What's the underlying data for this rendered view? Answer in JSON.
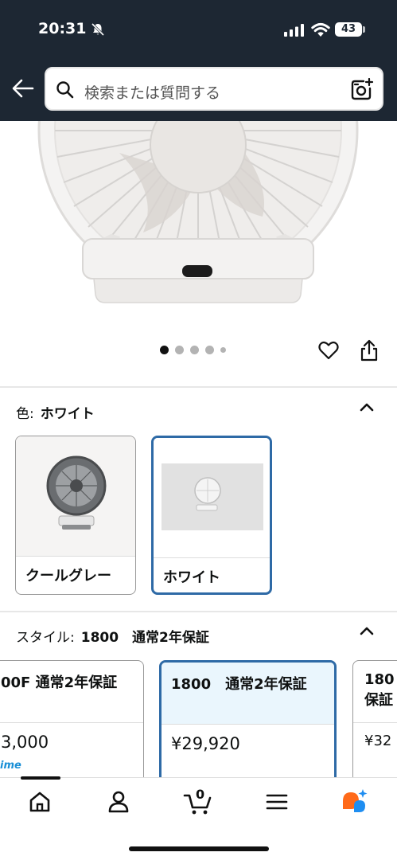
{
  "status_bar": {
    "time": "20:31",
    "battery": "43"
  },
  "search": {
    "placeholder": "検索または質問する"
  },
  "gallery": {
    "image_count": 5,
    "active_index": 0
  },
  "color_section": {
    "label": "色:",
    "selected": "ホワイト",
    "options": [
      {
        "label": "クールグレー",
        "selected": false
      },
      {
        "label": "ホワイト",
        "selected": true
      }
    ]
  },
  "style_section": {
    "label": "スタイル:",
    "selected": "1800　通常2年保証",
    "options": [
      {
        "title": "00F 通常2年保証",
        "price": "3,000",
        "selected": false
      },
      {
        "title": "1800　通常2年保証",
        "price": "¥29,920",
        "selected": true
      },
      {
        "title_line1": "180",
        "title_line2": "保証",
        "price": "¥32",
        "selected": false
      }
    ],
    "prime_text": "ime"
  },
  "tabbar": {
    "cart_count": "0"
  },
  "colors": {
    "header_bg": "#1d2733",
    "selected_border": "#2e6aa6",
    "selected_head_bg": "#eaf6fd",
    "prime_blue": "#1a8fd6",
    "ai_orange": "#ff6a1a",
    "ai_blue": "#1f8ef1"
  }
}
